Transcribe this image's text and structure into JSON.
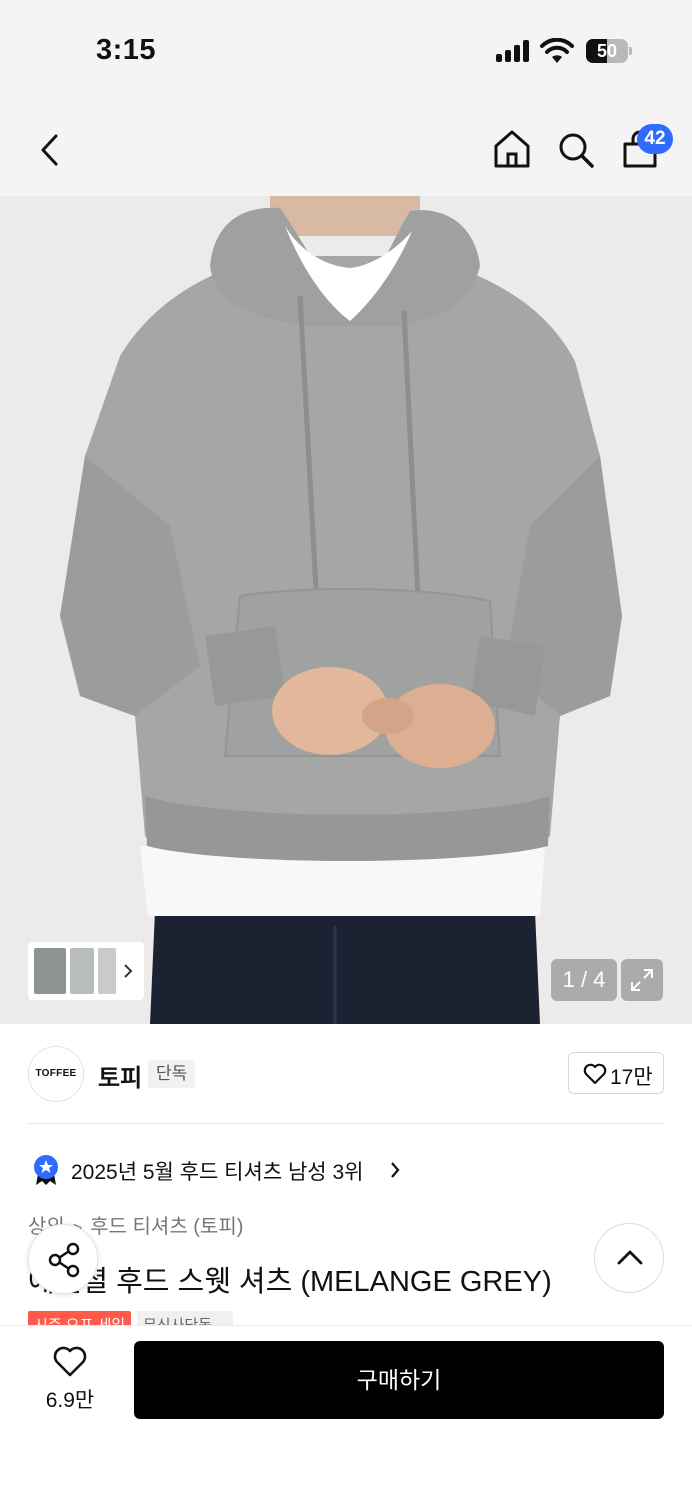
{
  "status_bar": {
    "time": "3:15",
    "battery": "50",
    "battery_level": 0.5
  },
  "nav": {
    "cart_count": "42"
  },
  "gallery": {
    "counter": "1 / 4"
  },
  "brand": {
    "logo_text": "TOFFEE",
    "name": "토피",
    "tag": "단독",
    "likes": "17만"
  },
  "ranking": {
    "text": "2025년 5월 후드 티셔츠 남성 3위"
  },
  "breadcrumb": {
    "items": [
      "상의",
      "후드 티셔츠 (토피)"
    ]
  },
  "product": {
    "title": "에센셜 후드 스웻 셔츠 (MELANGE GREY)",
    "badges": [
      "시즌 오프 세일",
      "무신사단독"
    ]
  },
  "bottom_bar": {
    "wish_count": "6.9만",
    "buy_label": "구매하기"
  },
  "colors": {
    "accent_blue": "#2f6bff",
    "sale_red": "#ff5a4a",
    "buy_black": "#000000"
  }
}
